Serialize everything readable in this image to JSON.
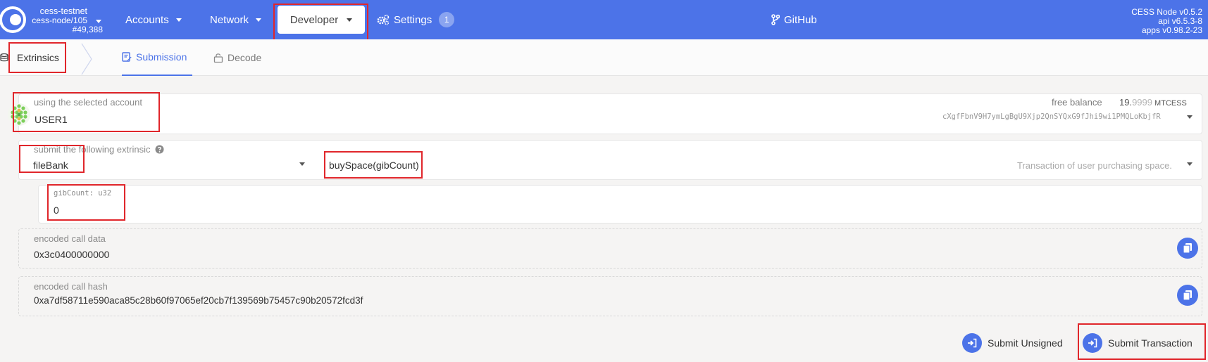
{
  "colors": {
    "accent": "#4c73e8",
    "highlight": "#e0262b"
  },
  "chain": {
    "name": "cess-testnet",
    "node": "cess-node/105",
    "block": "#49,388"
  },
  "nav": {
    "accounts": "Accounts",
    "network": "Network",
    "developer": "Developer",
    "settings": "Settings",
    "settings_badge": "1",
    "github": "GitHub"
  },
  "version": {
    "node": "CESS Node v0.5.2",
    "api": "api v6.5.3-8",
    "apps": "apps v0.98.2-23"
  },
  "tabs": {
    "app": "Extrinsics",
    "submission": "Submission",
    "decode": "Decode"
  },
  "account": {
    "label": "using the selected account",
    "name": "USER1",
    "balance_label": "free balance",
    "balance_int": "19.",
    "balance_frac": "9999",
    "balance_unit": " MTCESS",
    "address": "cXgfFbnV9H7ymLgBgU9Xjp2QnSYQxG9fJhi9wi1PMQLoKbjfR"
  },
  "extrinsic": {
    "label": "submit the following extrinsic",
    "help_icon": "question-circle-icon",
    "section": "fileBank",
    "method": "buySpace(gibCount)",
    "description": "Transaction of user purchasing space."
  },
  "param": {
    "label": "gibCount: u32",
    "value": "0"
  },
  "encoded": {
    "data_label": "encoded call data",
    "data_value": "0x3c0400000000",
    "hash_label": "encoded call hash",
    "hash_value": "0xa7df58711e590aca85c28b60f97065ef20cb7f139569b75457c90b20572fcd3f"
  },
  "actions": {
    "unsigned": "Submit Unsigned",
    "submit": "Submit Transaction"
  }
}
